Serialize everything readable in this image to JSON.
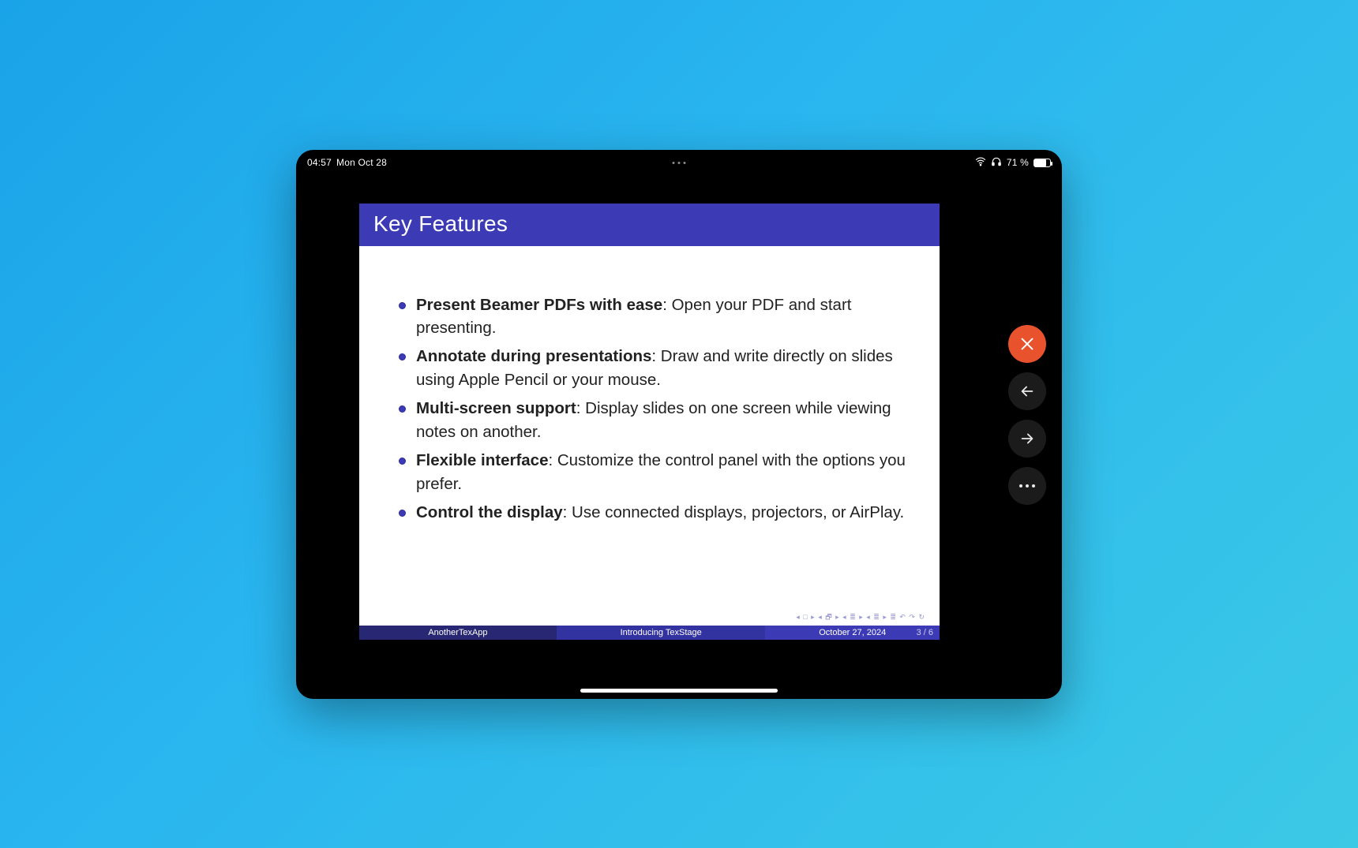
{
  "status": {
    "time": "04:57",
    "date": "Mon Oct 28",
    "battery_pct": "71 %"
  },
  "slide": {
    "title": "Key Features",
    "bullets": [
      {
        "head": "Present Beamer PDFs with ease",
        "tail": ": Open your PDF and start presenting."
      },
      {
        "head": "Annotate during presentations",
        "tail": ": Draw and write directly on slides using Apple Pencil or your mouse."
      },
      {
        "head": "Multi-screen support",
        "tail": ": Display slides on one screen while viewing notes on another."
      },
      {
        "head": "Flexible interface",
        "tail": ": Customize the control panel with the options you prefer."
      },
      {
        "head": "Control the display",
        "tail": ": Use connected displays, projectors, or AirPlay."
      }
    ],
    "footer": {
      "author": "AnotherTexApp",
      "title": "Introducing TexStage",
      "date": "October 27, 2024",
      "page": "3 / 6"
    },
    "nav_symbols": "◂ □ ▸   ◂ 🗗 ▸   ◂ ≣ ▸   ◂ ≣ ▸    ≣    ↶ ↷ ↻"
  },
  "controls": {
    "close_name": "close",
    "prev_name": "previous-slide",
    "next_name": "next-slide",
    "more_name": "more-options"
  }
}
